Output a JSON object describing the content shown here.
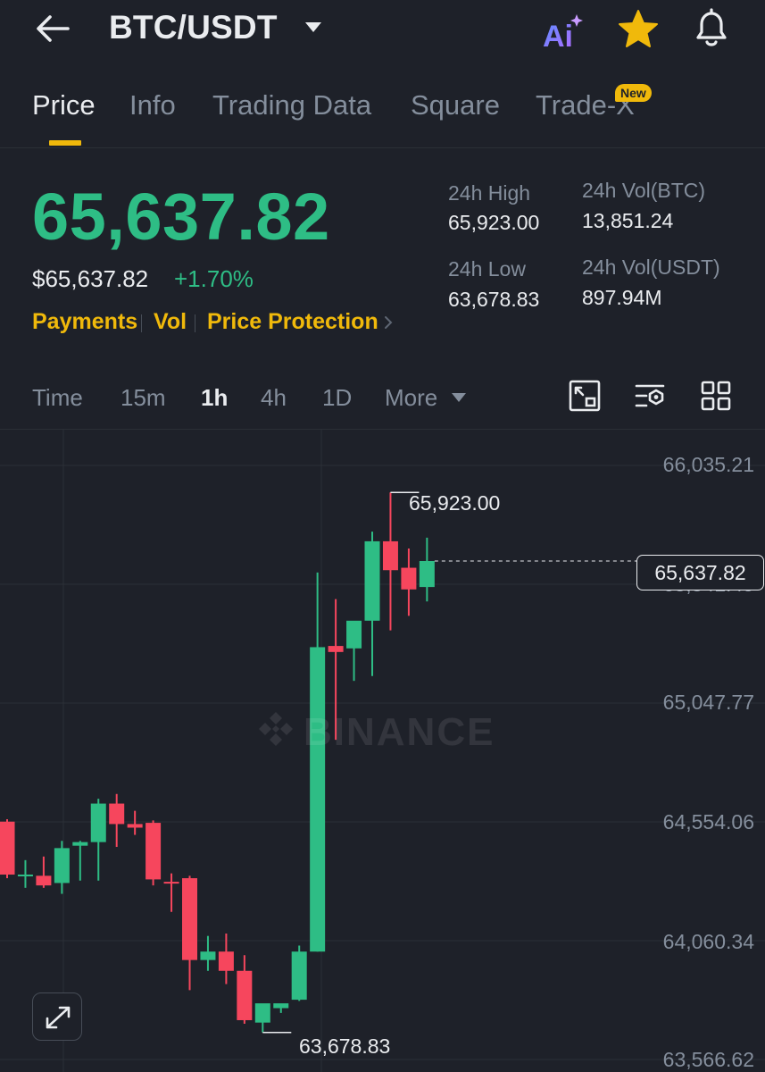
{
  "header": {
    "pair": "BTC/USDT",
    "icons": [
      "back-arrow-icon",
      "chevron-down-icon",
      "ai-icon",
      "star-icon",
      "bell-icon"
    ]
  },
  "tabs": [
    {
      "label": "Price",
      "active": true
    },
    {
      "label": "Info"
    },
    {
      "label": "Trading Data"
    },
    {
      "label": "Square"
    },
    {
      "label": "Trade-X",
      "badge": "New"
    }
  ],
  "ticker": {
    "price": "65,637.82",
    "usd_price": "$65,637.82",
    "change": "+1.70%",
    "links": [
      "Payments",
      "Vol",
      "Price Protection"
    ],
    "stats": {
      "high_label": "24h High",
      "high_value": "65,923.00",
      "low_label": "24h Low",
      "low_value": "63,678.83",
      "vol_btc_label": "24h Vol(BTC)",
      "vol_btc_value": "13,851.24",
      "vol_usdt_label": "24h Vol(USDT)",
      "vol_usdt_value": "897.94M"
    }
  },
  "intervals": {
    "items": [
      "Time",
      "15m",
      "1h",
      "4h",
      "1D",
      "More"
    ],
    "active": "1h",
    "tools": [
      "depth-chart-icon",
      "indicator-settings-icon",
      "grid-layout-icon"
    ]
  },
  "chart": {
    "watermark": "BINANCE",
    "current_price_label": "65,637.82",
    "high_label": "65,923.00",
    "low_label": "63,678.83",
    "y_ticks": [
      "66,035.21",
      "65,541.49",
      "65,047.77",
      "64,554.06",
      "64,060.34",
      "63,566.62"
    ],
    "colors": {
      "up": "#2ebd85",
      "down": "#f6465d",
      "accent": "#f0b90b",
      "bg": "#1e2129"
    }
  },
  "chart_data": {
    "type": "candlestick",
    "interval": "1h",
    "ylim": [
      63566.62,
      66035.21
    ],
    "candles": [
      {
        "o": 64555,
        "h": 64565,
        "c": 64335,
        "l": 64320
      },
      {
        "o": 64330,
        "h": 64395,
        "c": 64335,
        "l": 64280
      },
      {
        "o": 64330,
        "h": 64410,
        "c": 64290,
        "l": 64280
      },
      {
        "o": 64300,
        "h": 64475,
        "c": 64445,
        "l": 64255
      },
      {
        "o": 64455,
        "h": 64475,
        "c": 64470,
        "l": 64310
      },
      {
        "o": 64470,
        "h": 64650,
        "c": 64630,
        "l": 64310
      },
      {
        "o": 64630,
        "h": 64670,
        "c": 64545,
        "l": 64450
      },
      {
        "o": 64545,
        "h": 64600,
        "c": 64530,
        "l": 64500
      },
      {
        "o": 64550,
        "h": 64560,
        "c": 64315,
        "l": 64290
      },
      {
        "o": 64305,
        "h": 64340,
        "c": 64300,
        "l": 64180
      },
      {
        "o": 64320,
        "h": 64330,
        "c": 63980,
        "l": 63855
      },
      {
        "o": 63980,
        "h": 64080,
        "c": 64015,
        "l": 63935
      },
      {
        "o": 64015,
        "h": 64090,
        "c": 63935,
        "l": 63880
      },
      {
        "o": 63935,
        "h": 64000,
        "c": 63730,
        "l": 63715
      },
      {
        "o": 63720,
        "h": 63770,
        "c": 63800,
        "l": 63679
      },
      {
        "o": 63780,
        "h": 63790,
        "c": 63800,
        "l": 63760
      },
      {
        "o": 63815,
        "h": 64040,
        "c": 64015,
        "l": 63810
      },
      {
        "o": 64015,
        "h": 65590,
        "c": 65280,
        "l": 64015
      },
      {
        "o": 65285,
        "h": 65480,
        "c": 65260,
        "l": 64895
      },
      {
        "o": 65275,
        "h": 65370,
        "c": 65390,
        "l": 65140
      },
      {
        "o": 65390,
        "h": 65760,
        "c": 65720,
        "l": 65160
      },
      {
        "o": 65720,
        "h": 65923,
        "c": 65600,
        "l": 65350
      },
      {
        "o": 65610,
        "h": 65690,
        "c": 65520,
        "l": 65410
      },
      {
        "o": 65530,
        "h": 65735,
        "c": 65638,
        "l": 65470
      }
    ]
  }
}
